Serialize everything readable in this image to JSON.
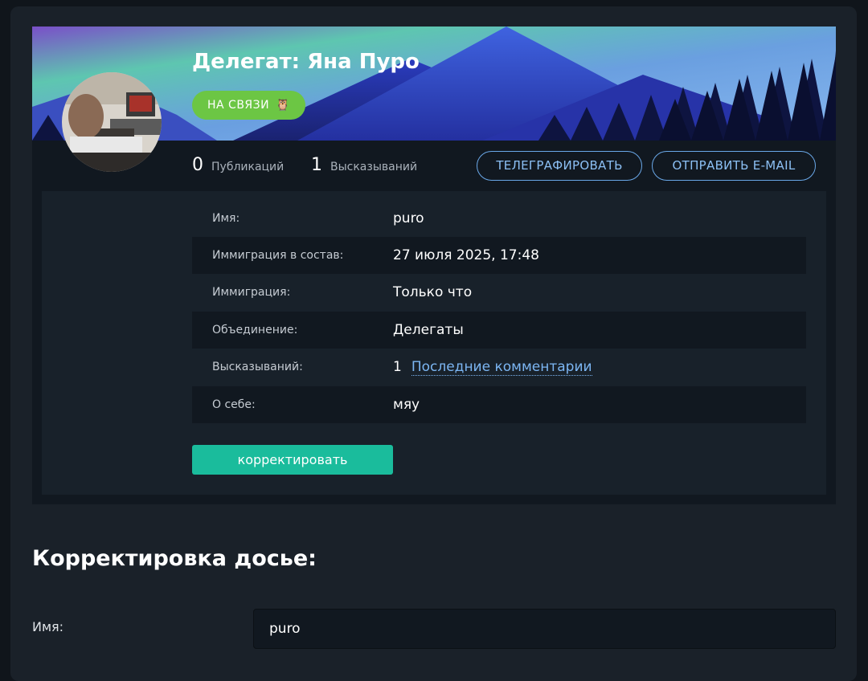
{
  "profile": {
    "title": "Делегат: Яна Пуро",
    "status": "НА СВЯЗИ",
    "status_icon": "owl-icon",
    "stats": [
      {
        "count": "0",
        "label": "Публикаций"
      },
      {
        "count": "1",
        "label": "Высказываний"
      }
    ],
    "buttons": {
      "telegraph": "ТЕЛЕГРАФИРОВАТЬ",
      "email": "ОТПРАВИТЬ E-MAIL"
    }
  },
  "info": {
    "rows": [
      {
        "label": "Имя:",
        "value": "puro"
      },
      {
        "label": "Иммиграция в состав:",
        "value": "27 июля 2025, 17:48"
      },
      {
        "label": "Иммиграция:",
        "value": "Только что"
      },
      {
        "label": "Объединение:",
        "value": "Делегаты"
      },
      {
        "label": "Высказываний:",
        "value": "1",
        "link": "Последние комментарии"
      },
      {
        "label": "О себе:",
        "value": "мяу"
      }
    ],
    "edit_button": "корректировать"
  },
  "edit_form": {
    "title": "Корректировка досье:",
    "name_label": "Имя:",
    "name_value": "puro"
  },
  "colors": {
    "status": "#6cc644",
    "accent": "#1abc9c",
    "link": "#7cb6f3"
  }
}
